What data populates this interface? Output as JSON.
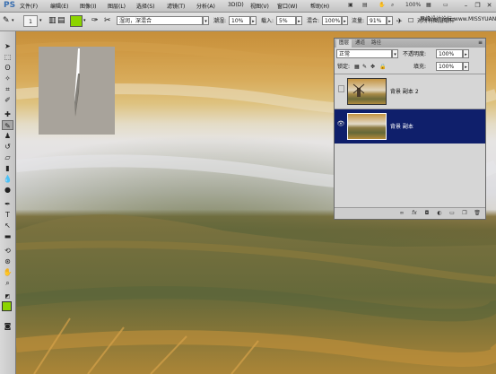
{
  "app": {
    "logo": "PS"
  },
  "menu": {
    "items": [
      "文件(F)",
      "编辑(E)",
      "图像(I)",
      "图层(L)",
      "选择(S)",
      "滤镜(T)",
      "分析(A)",
      "3D(D)",
      "视图(V)",
      "窗口(W)",
      "帮助(H)"
    ],
    "zoom": "100%"
  },
  "options": {
    "brush_size": "1",
    "mode": "湿润，深混合",
    "wet_label": "潮湿:",
    "wet_value": "10%",
    "load_label": "载入:",
    "load_value": "5%",
    "mix_label": "混合:",
    "mix_value": "100%",
    "flow_label": "流量:",
    "flow_value": "91%",
    "sample_all_label": "对所有图层取样",
    "fg_color": "#8cd400"
  },
  "watermark": "思缘设计论坛 www.MISSYUAN.COM",
  "layers_panel": {
    "tabs": [
      "图层",
      "通道",
      "路径"
    ],
    "blend_mode": "正常",
    "opacity_label": "不透明度:",
    "opacity_value": "100%",
    "lock_label": "锁定:",
    "fill_label": "填充:",
    "fill_value": "100%",
    "layers": [
      {
        "name": "背景 副本 2",
        "visible": false,
        "selected": false
      },
      {
        "name": "背景 副本",
        "visible": true,
        "selected": true
      }
    ],
    "bottom_icons": [
      "link-icon",
      "fx-icon",
      "mask-icon",
      "adjustment-icon",
      "group-icon",
      "new-layer-icon",
      "trash-icon"
    ],
    "selected_color": "#0f1f6b"
  }
}
